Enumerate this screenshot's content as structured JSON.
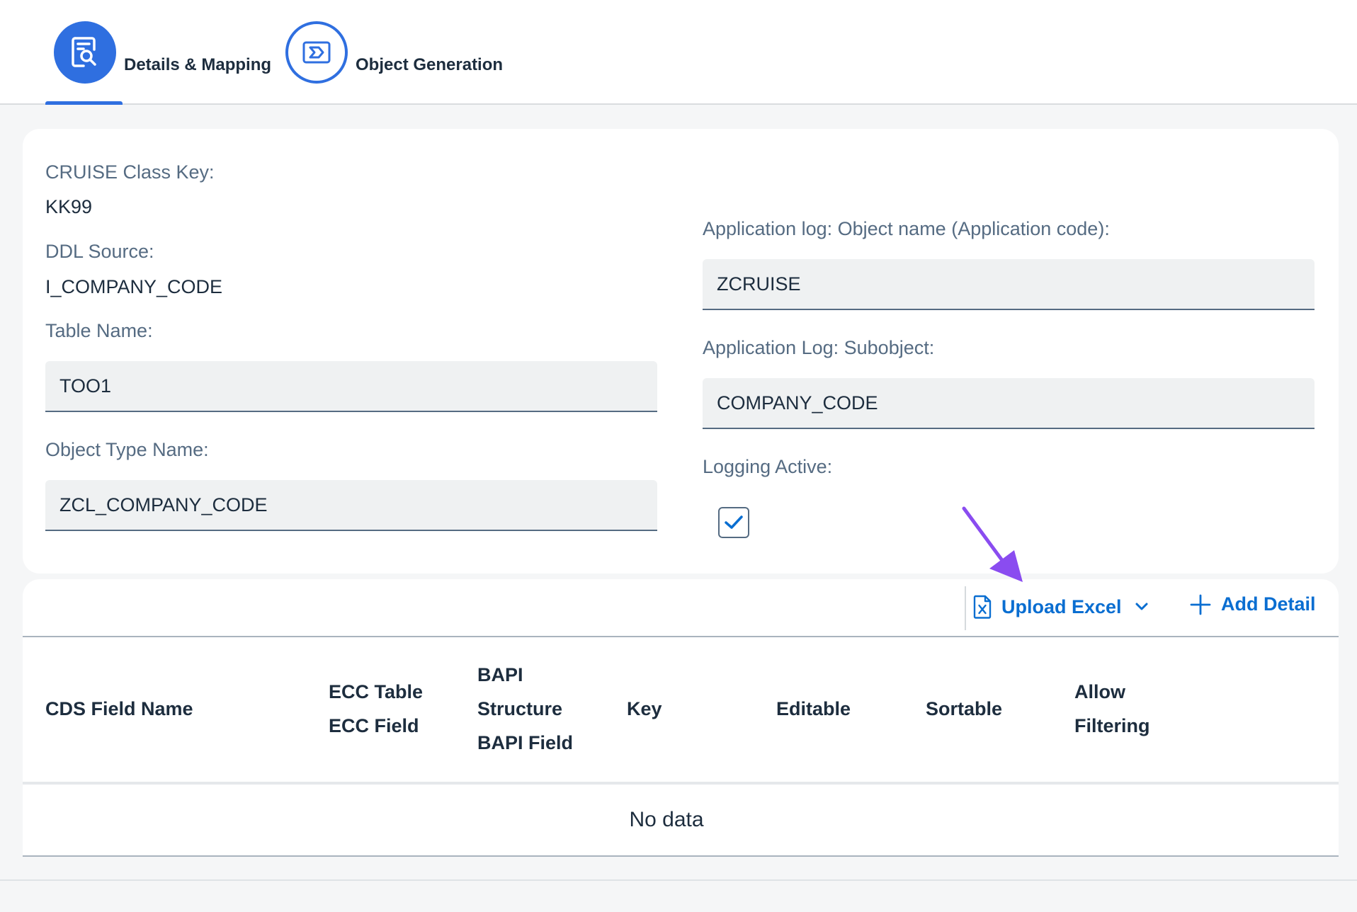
{
  "steps": [
    {
      "label": "Details & Mapping",
      "icon": "document-search-icon",
      "active": true
    },
    {
      "label": "Object Generation",
      "icon": "object-generation-icon",
      "active": false
    }
  ],
  "form": {
    "class_key_label": "CRUISE Class Key:",
    "class_key_value": "KK99",
    "ddl_label": "DDL Source:",
    "ddl_value": "I_COMPANY_CODE",
    "table_name_label": "Table Name:",
    "table_name_value": "TOO1",
    "object_type_label": "Object Type Name:",
    "object_type_value": "ZCL_COMPANY_CODE",
    "app_log_object_label": "Application log: Object name (Application code):",
    "app_log_object_value": "ZCRUISE",
    "app_log_subobject_label": "Application Log: Subobject:",
    "app_log_subobject_value": "COMPANY_CODE",
    "logging_active_label": "Logging Active:",
    "logging_active_checked": true
  },
  "toolbar": {
    "upload_label": "Upload Excel",
    "upload_icon": "excel-file-icon",
    "add_label": "Add Detail",
    "add_icon": "plus-icon"
  },
  "table": {
    "columns": [
      [
        "CDS Field Name"
      ],
      [
        "ECC Table",
        "ECC Field"
      ],
      [
        "BAPI",
        "Structure",
        "BAPI Field"
      ],
      [
        "Key"
      ],
      [
        "Editable"
      ],
      [
        "Sortable"
      ],
      [
        "Allow",
        "Filtering"
      ]
    ],
    "empty_text": "No data"
  },
  "colors": {
    "accent": "#2f6fe0",
    "link": "#0a6ed1",
    "annotation_arrow": "#8a4cf0"
  }
}
